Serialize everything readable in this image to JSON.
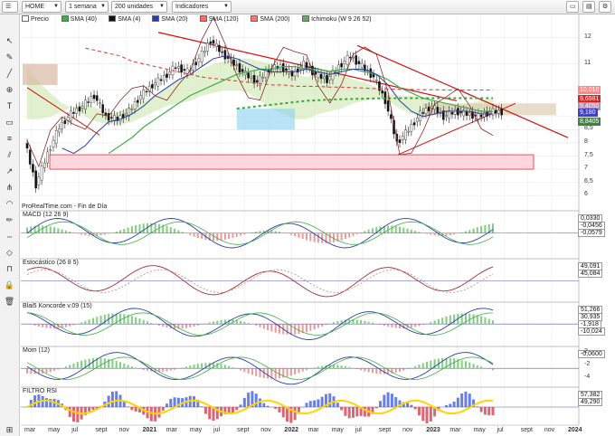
{
  "toolbar": {
    "symbol": "HOME",
    "timeframe": "1 semana",
    "units": "200 unidades",
    "indicators": "Indicadores"
  },
  "price_panel": {
    "legend": [
      {
        "label": "Precio",
        "color": "#ffffff"
      },
      {
        "label": "SMA (40)",
        "color": "#3fae49"
      },
      {
        "label": "SMA (4)",
        "color": "#111111"
      },
      {
        "label": "SMA (20)",
        "color": "#2e3aa8"
      },
      {
        "label": "SMA (120)",
        "color": "#ff6a6a"
      },
      {
        "label": "SMA (200)",
        "color": "#ff7777"
      },
      {
        "label": "Ichimoku (W 9 26 52)",
        "color": "#6aa86a"
      }
    ],
    "watermark": "ProRealTime.com - Fin de Día",
    "y_ticks": [
      "12",
      "11",
      "10",
      "9",
      "8,5",
      "8",
      "7,5",
      "7",
      "6,5",
      "6"
    ],
    "flags": [
      {
        "text": "10,010",
        "color": "#ff8888"
      },
      {
        "text": "9,6981",
        "color": "#dd2222"
      },
      {
        "text": "9,4050",
        "color": "#b08fb0"
      },
      {
        "text": "9,180",
        "color": "#4040c0"
      },
      {
        "text": "8,8405",
        "color": "#4a7a4a"
      }
    ]
  },
  "panels": [
    {
      "title": "MACD (12 26 9)",
      "flags": [
        "0,0330",
        "-0,0456",
        "-0,0579"
      ],
      "axis": []
    },
    {
      "title": "Estocástico (26 8 5)",
      "flags": [
        "49,091",
        "45,084"
      ],
      "axis": []
    },
    {
      "title": "Blai5 Koncorde v.09 (15)",
      "flags": [
        "51,266",
        "30,935",
        "-1,918",
        "-10,024"
      ],
      "axis": []
    },
    {
      "title": "Mom (12)",
      "flags": [
        "-0,0600"
      ],
      "axis": [
        "2",
        "-2",
        "-4"
      ]
    },
    {
      "title": "FILTRO RSI",
      "flags": [
        "57,382",
        "49,290"
      ],
      "axis": []
    }
  ],
  "x_axis": [
    "mar",
    "may",
    "jul",
    "sept",
    "nov",
    "2021",
    "mar",
    "may",
    "jul",
    "sept",
    "nov",
    "2022",
    "mar",
    "may",
    "jul",
    "sept",
    "nov",
    "2023",
    "mar",
    "may",
    "jul",
    "sept",
    "nov",
    "2024"
  ],
  "chart_data": {
    "type": "line",
    "title": "HOME",
    "x": [
      "2020-03",
      "2020-04",
      "2020-05",
      "2020-06",
      "2020-07",
      "2020-08",
      "2020-09",
      "2020-10",
      "2020-11",
      "2020-12",
      "2021-01",
      "2021-02",
      "2021-03",
      "2021-04",
      "2021-05",
      "2021-06",
      "2021-07",
      "2021-08",
      "2021-09",
      "2021-10",
      "2021-11",
      "2021-12",
      "2022-01",
      "2022-02",
      "2022-03",
      "2022-04",
      "2022-05",
      "2022-06",
      "2022-07",
      "2022-08",
      "2022-09",
      "2022-10",
      "2022-11",
      "2022-12",
      "2023-01",
      "2023-02",
      "2023-03",
      "2023-04",
      "2023-05",
      "2023-06",
      "2023-07"
    ],
    "series": [
      {
        "name": "Precio",
        "values": [
          8.1,
          6.4,
          7.6,
          8.6,
          9.1,
          9.4,
          9.8,
          9.0,
          8.9,
          9.2,
          9.8,
          10.2,
          10.5,
          10.9,
          10.7,
          11.2,
          11.9,
          11.4,
          11.0,
          10.6,
          10.3,
          10.8,
          10.9,
          10.6,
          11.0,
          10.6,
          10.4,
          10.9,
          11.3,
          10.9,
          10.5,
          9.6,
          8.0,
          8.5,
          9.1,
          9.4,
          9.0,
          9.2,
          9.1,
          9.0,
          9.18
        ]
      },
      {
        "name": "SMA (40)",
        "values": [
          null,
          null,
          null,
          null,
          null,
          null,
          null,
          7.6,
          7.9,
          8.2,
          8.6,
          8.9,
          9.2,
          9.5,
          9.8,
          10.0,
          10.2,
          10.4,
          10.6,
          10.7,
          10.8,
          10.8,
          10.9,
          10.9,
          10.8,
          10.8,
          10.7,
          10.8,
          10.8,
          10.7,
          10.6,
          10.4,
          10.1,
          9.9,
          9.7,
          9.6,
          9.5,
          9.4,
          9.3,
          9.2,
          9.2
        ]
      },
      {
        "name": "SMA (20)",
        "values": [
          null,
          null,
          null,
          7.8,
          7.6,
          7.9,
          8.4,
          8.8,
          8.9,
          9.1,
          9.4,
          9.8,
          10.1,
          10.4,
          10.6,
          10.9,
          11.2,
          11.3,
          11.2,
          11.0,
          10.8,
          10.7,
          10.7,
          10.7,
          10.8,
          10.7,
          10.6,
          10.7,
          10.8,
          10.8,
          10.6,
          10.2,
          9.6,
          9.2,
          9.0,
          9.1,
          9.2,
          9.2,
          9.2,
          9.1,
          9.1
        ]
      },
      {
        "name": "SMA (120)",
        "values": [
          null,
          null,
          null,
          null,
          null,
          11.6,
          11.5,
          11.4,
          11.3,
          11.1,
          11.0,
          10.9,
          10.8,
          10.7,
          10.6,
          10.5,
          10.45,
          10.4,
          10.35,
          10.3,
          10.25,
          10.2,
          10.2,
          10.15,
          10.15,
          10.15,
          10.12,
          10.12,
          10.1,
          10.08,
          10.06,
          10.05,
          10.04,
          10.03,
          10.02,
          10.02,
          10.01,
          10.01,
          10.01,
          10.01,
          10.01
        ]
      },
      {
        "name": "SMA (200)",
        "values": [
          null,
          null,
          null,
          null,
          null,
          null,
          null,
          null,
          null,
          null,
          null,
          null,
          null,
          null,
          null,
          null,
          null,
          null,
          9.3,
          9.35,
          9.4,
          9.45,
          9.5,
          9.55,
          9.6,
          9.62,
          9.64,
          9.66,
          9.67,
          9.68,
          9.69,
          9.69,
          9.7,
          9.7,
          9.7,
          9.7,
          9.7,
          9.7,
          9.7,
          9.7,
          9.7
        ]
      }
    ],
    "ylim": [
      5.8,
      12.5
    ],
    "grid": true,
    "legend_position": "top-left"
  }
}
